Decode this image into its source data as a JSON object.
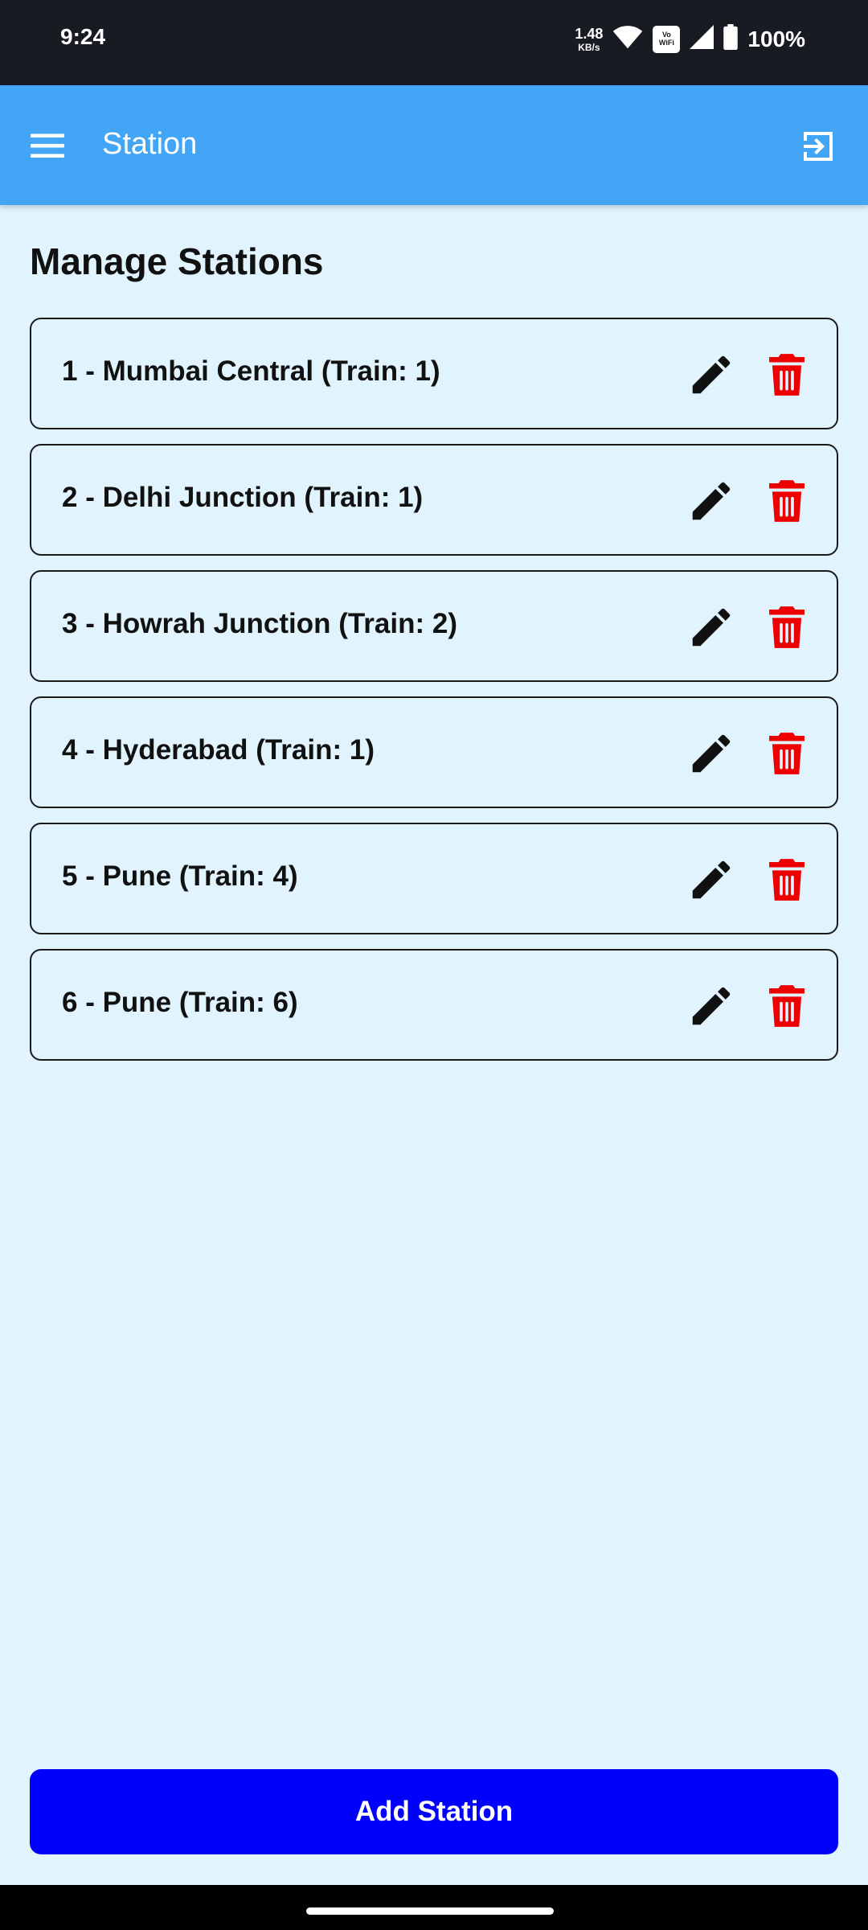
{
  "status_bar": {
    "time": "9:24",
    "net_speed_value": "1.48",
    "net_speed_unit": "KB/s",
    "vowifi_top": "Vo",
    "vowifi_bottom": "WiFi",
    "battery_percent": "100%",
    "icons": [
      "wifi-icon",
      "vowifi-icon",
      "signal-icon",
      "battery-icon"
    ]
  },
  "app_bar": {
    "title": "Station",
    "menu_icon": "menu-icon",
    "logout_icon": "logout-icon",
    "color": "#42a5f5"
  },
  "page": {
    "heading": "Manage Stations",
    "background": "#e1f4fd"
  },
  "stations": [
    {
      "label": "1 - Mumbai Central (Train: 1)"
    },
    {
      "label": "2 - Delhi Junction (Train: 1)"
    },
    {
      "label": "3 - Howrah Junction (Train: 2)"
    },
    {
      "label": "4 - Hyderabad (Train: 1)"
    },
    {
      "label": "5 - Pune (Train: 4)"
    },
    {
      "label": "6 - Pune (Train: 6)"
    }
  ],
  "station_actions": {
    "edit_icon": "pencil-icon",
    "delete_icon": "trash-icon",
    "delete_color": "#ee0000"
  },
  "footer": {
    "add_label": "Add Station",
    "add_color": "#0000fb"
  }
}
